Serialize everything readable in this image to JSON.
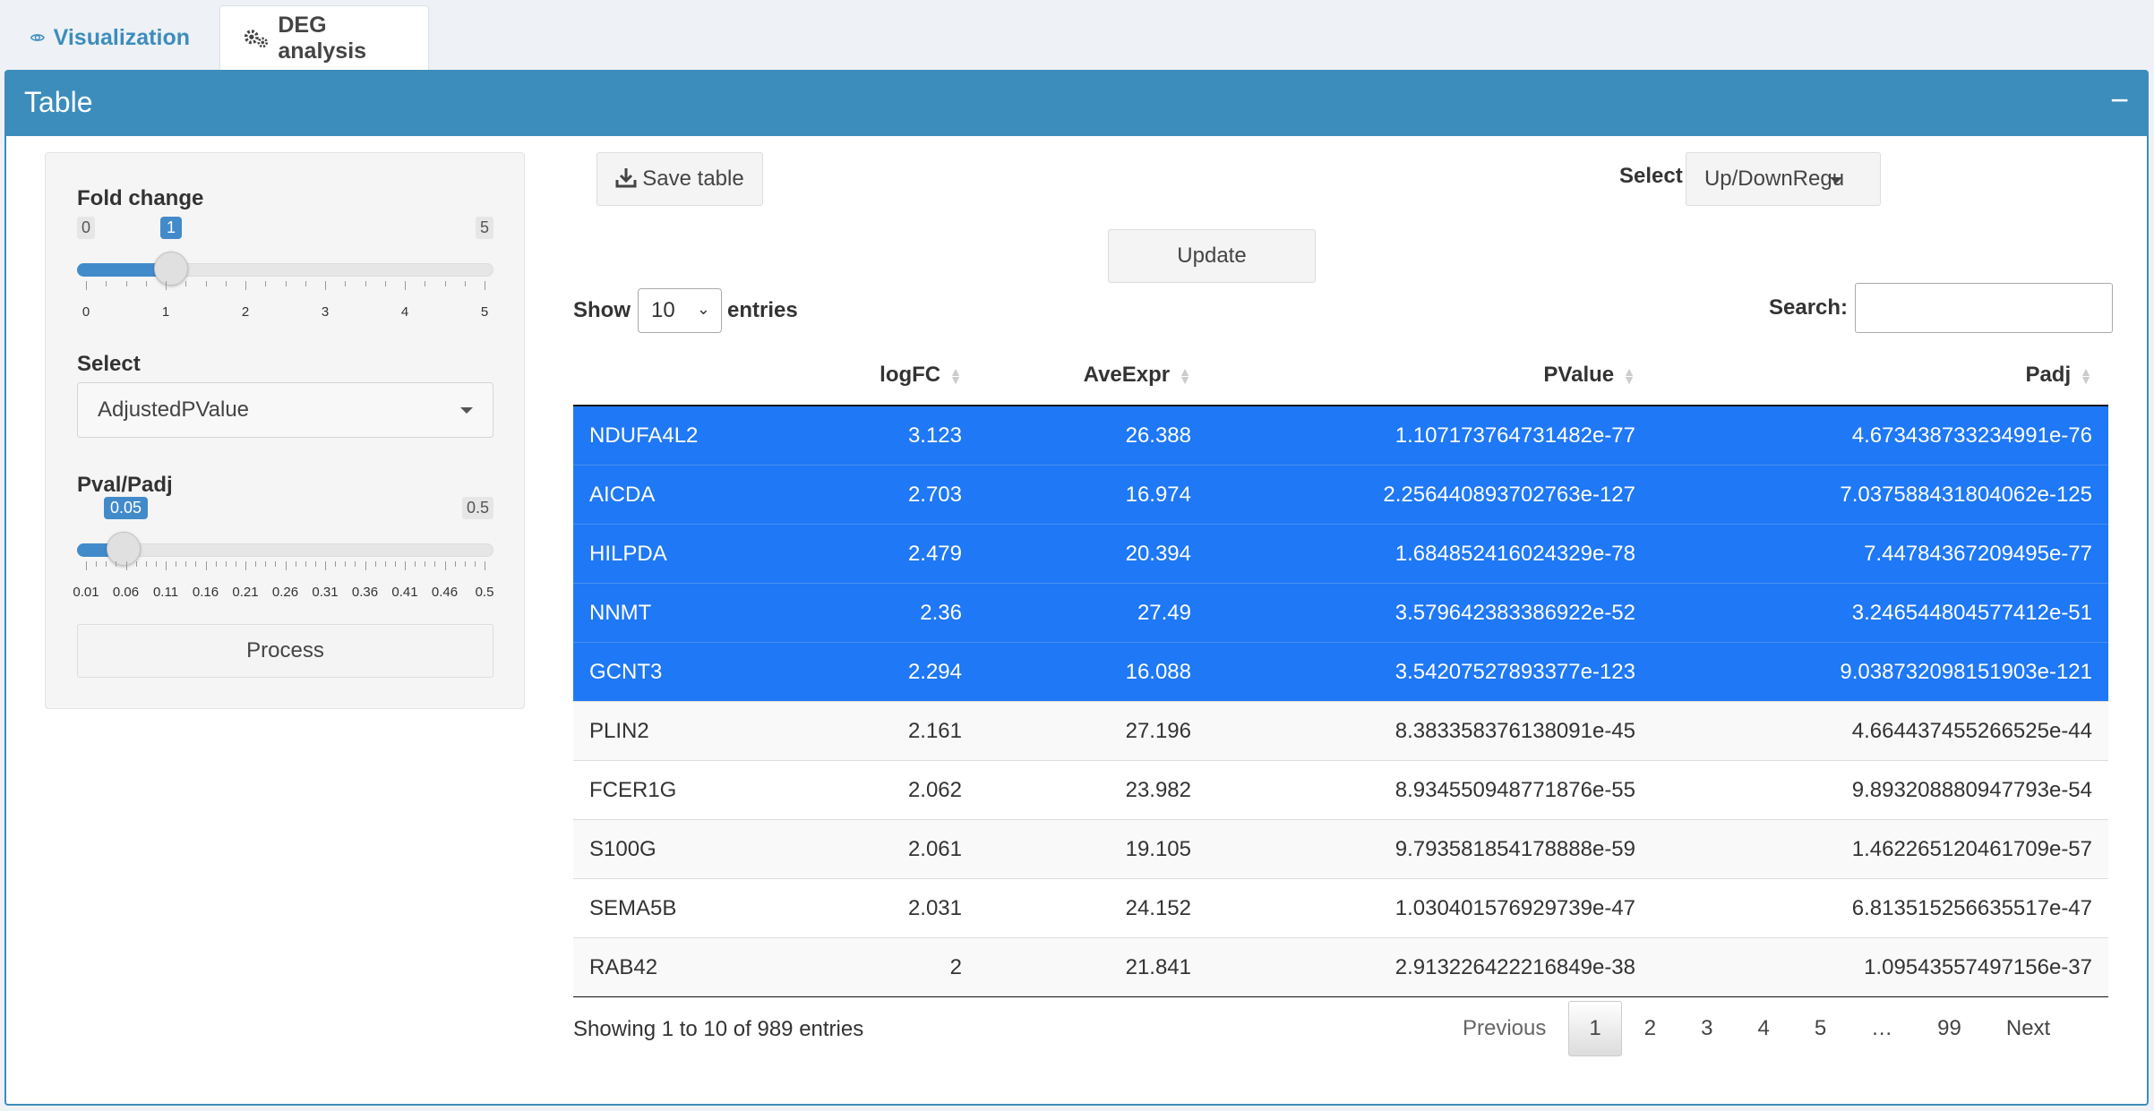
{
  "tabs": [
    {
      "label": "Visualization",
      "icon": "eye-icon",
      "active": false
    },
    {
      "label": "DEG analysis",
      "icon": "gears-icon",
      "active": true
    }
  ],
  "box": {
    "title": "Table",
    "collapse_label": "−"
  },
  "colors": {
    "primary": "#3c8dbc",
    "selected_row": "#1f78f5",
    "slider": "#428bca"
  },
  "sidebar": {
    "fold_change": {
      "label": "Fold change",
      "min": "0",
      "max": "5",
      "value": "1",
      "ticks": [
        "0",
        "1",
        "2",
        "3",
        "4",
        "5"
      ]
    },
    "select": {
      "label": "Select",
      "value": "AdjustedPValue"
    },
    "pval": {
      "label": "Pval/Padj",
      "min": "0.01",
      "max": "0.5",
      "value": "0.05",
      "ticks": [
        "0.01",
        "0.06",
        "0.11",
        "0.16",
        "0.21",
        "0.26",
        "0.31",
        "0.36",
        "0.41",
        "0.46",
        "0.5"
      ]
    },
    "process_label": "Process"
  },
  "toolbar": {
    "save_label": "Save table",
    "select_label": "Select",
    "updown_value": "Up/DownRegu",
    "update_label": "Update"
  },
  "length": {
    "show": "Show",
    "value": "10",
    "entries": "entries"
  },
  "search": {
    "label": "Search:",
    "value": ""
  },
  "table": {
    "columns": [
      "",
      "logFC",
      "AveExpr",
      "PValue",
      "Padj"
    ],
    "rows": [
      [
        "NDUFA4L2",
        "3.123",
        "26.388",
        "1.107173764731482e-77",
        "4.673438733234991e-76"
      ],
      [
        "AICDA",
        "2.703",
        "16.974",
        "2.256440893702763e-127",
        "7.037588431804062e-125"
      ],
      [
        "HILPDA",
        "2.479",
        "20.394",
        "1.684852416024329e-78",
        "7.44784367209495e-77"
      ],
      [
        "NNMT",
        "2.36",
        "27.49",
        "3.579642383386922e-52",
        "3.246544804577412e-51"
      ],
      [
        "GCNT3",
        "2.294",
        "16.088",
        "3.54207527893377e-123",
        "9.038732098151903e-121"
      ],
      [
        "PLIN2",
        "2.161",
        "27.196",
        "8.383358376138091e-45",
        "4.664437455266525e-44"
      ],
      [
        "FCER1G",
        "2.062",
        "23.982",
        "8.934550948771876e-55",
        "9.893208880947793e-54"
      ],
      [
        "S100G",
        "2.061",
        "19.105",
        "9.793581854178888e-59",
        "1.462265120461709e-57"
      ],
      [
        "SEMA5B",
        "2.031",
        "24.152",
        "1.030401576929739e-47",
        "6.813515256635517e-47"
      ],
      [
        "RAB42",
        "2",
        "21.841",
        "2.913226422216849e-38",
        "1.09543557497156e-37"
      ]
    ],
    "selected_rows": [
      0,
      1,
      2,
      3,
      4
    ]
  },
  "info": "Showing 1 to 10 of 989 entries",
  "pagination": {
    "previous": "Previous",
    "pages": [
      "1",
      "2",
      "3",
      "4",
      "5",
      "…",
      "99"
    ],
    "current": "1",
    "next": "Next"
  }
}
